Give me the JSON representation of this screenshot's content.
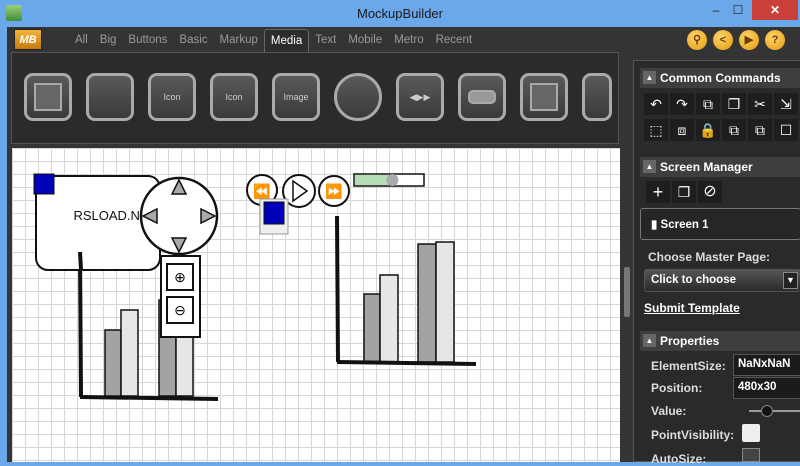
{
  "window": {
    "title": "MockupBuilder",
    "min": "‒",
    "max": "☐",
    "close": "✕"
  },
  "logo": "MB",
  "tabs": [
    "All",
    "Big",
    "Buttons",
    "Basic",
    "Markup",
    "Media",
    "Text",
    "Mobile",
    "Metro",
    "Recent"
  ],
  "active_tab": "Media",
  "toolbar_icons": [
    "search-icon",
    "share-icon",
    "play-icon",
    "help-icon"
  ],
  "toolbar_glyphs": [
    "⚲",
    "<",
    "▶",
    "?"
  ],
  "palette_labels": {
    "icon": "Icon",
    "icon_text": "Icon",
    "image": "Image"
  },
  "canvas": {
    "callout_text": "RSLOAD.NET",
    "slider_value": 0.55
  },
  "panel": {
    "common_commands": "Common Commands",
    "command_glyphs": [
      "↶",
      "↷",
      "⧉",
      "❐",
      "✂",
      "⇲",
      "⬚",
      "⧈",
      "🔒",
      "⧉",
      "⧉",
      "☐"
    ],
    "screen_manager": "Screen Manager",
    "screen_glyphs": [
      "+",
      "❐",
      "⃠"
    ],
    "screen_item": "Screen 1",
    "master_label": "Choose Master Page:",
    "master_select": "Click to choose",
    "submit": "Submit Template",
    "properties": "Properties",
    "element_size_label": "ElementSize:",
    "element_size": "NaNxNaN",
    "position_label": "Position:",
    "position": "480x30",
    "value_label": "Value:",
    "point_visibility_label": "PointVisibility:",
    "auto_size_label": "AutoSize:"
  }
}
